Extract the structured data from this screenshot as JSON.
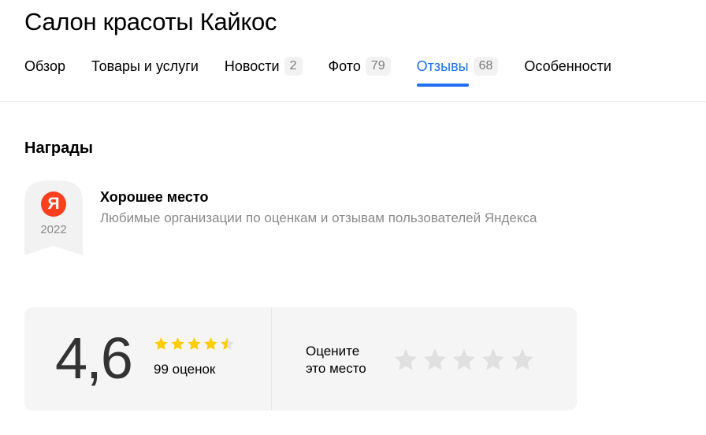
{
  "page": {
    "title": "Салон красоты Кайкос"
  },
  "tabs": [
    {
      "label": "Обзор",
      "count": ""
    },
    {
      "label": "Товары и услуги",
      "count": ""
    },
    {
      "label": "Новости",
      "count": "2"
    },
    {
      "label": "Фото",
      "count": "79"
    },
    {
      "label": "Отзывы",
      "count": "68",
      "active": true
    },
    {
      "label": "Особенности",
      "count": ""
    }
  ],
  "awards": {
    "title": "Награды",
    "item": {
      "logo_letter": "Я",
      "year": "2022",
      "name": "Хорошее место",
      "description": "Любимые организации по оценкам и отзывам пользователей Яндекса"
    }
  },
  "rating": {
    "value": "4,6",
    "stars_filled": 4.5,
    "count_label": "99 оценок",
    "prompt_line1": "Оцените",
    "prompt_line2": "это место",
    "rate_star_count": 5
  },
  "colors": {
    "accent": "#1e6ff1",
    "star_filled": "#ffcc00",
    "star_empty": "#e0e0e0",
    "yandex_red": "#fc3f1d"
  },
  "icons": {
    "award_badge": "award-ribbon-icon",
    "rating_star": "star-icon"
  }
}
